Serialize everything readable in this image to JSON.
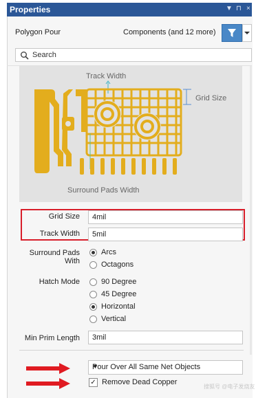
{
  "window": {
    "title": "Properties",
    "controls": [
      "▼",
      "⊓",
      "×"
    ]
  },
  "header": {
    "object": "Polygon Pour",
    "selection": "Components (and 12 more)"
  },
  "search": {
    "placeholder": "Search"
  },
  "preview": {
    "track_width": "Track Width",
    "grid_size": "Grid Size",
    "surround_pads_width": "Surround Pads Width"
  },
  "props": {
    "grid_size_label": "Grid Size",
    "grid_size_value": "4mil",
    "track_width_label": "Track Width",
    "track_width_value": "5mil",
    "surround_label_1": "Surround Pads",
    "surround_label_2": "With",
    "surround_options": [
      "Arcs",
      "Octagons"
    ],
    "surround_selected": "Arcs",
    "hatch_label": "Hatch Mode",
    "hatch_options": [
      "90 Degree",
      "45 Degree",
      "Horizontal",
      "Vertical"
    ],
    "hatch_selected": "Horizontal",
    "min_prim_label": "Min Prim Length",
    "min_prim_value": "3mil"
  },
  "pour": {
    "select_value": "Pour Over All Same Net Objects",
    "remove_dead_copper_label": "Remove Dead Copper",
    "remove_dead_copper_checked": true
  },
  "watermark": "搜狐号 @电子发烧友",
  "colors": {
    "accent": "#4a88c7",
    "highlight": "#d81e2a",
    "copper": "#e3ad1d"
  }
}
